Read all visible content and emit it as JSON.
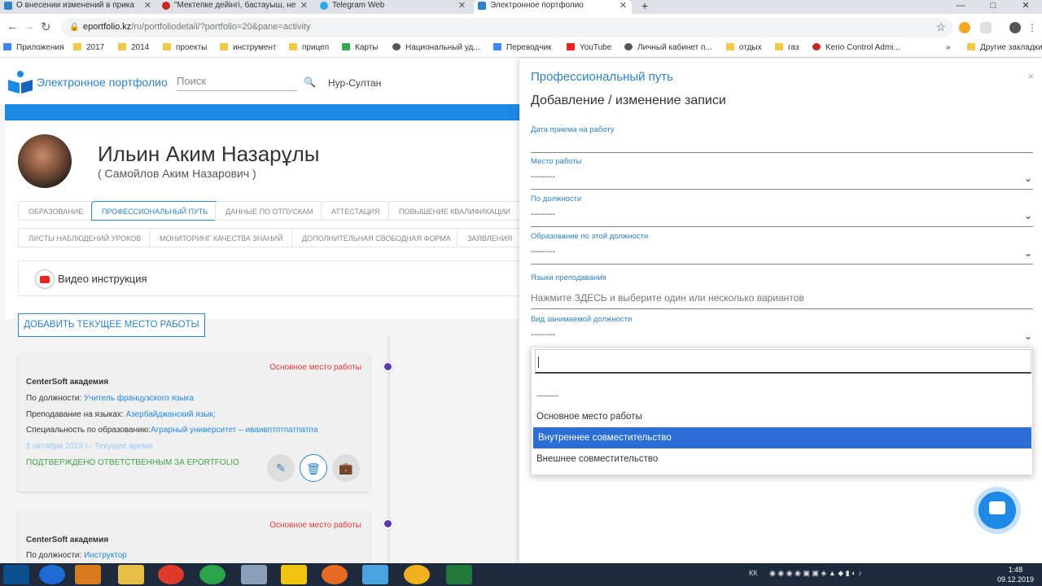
{
  "browser": {
    "tabs": [
      {
        "title": "О внесении изменений в прика",
        "color": "#2e82c6"
      },
      {
        "title": "\"Мектепке дейінгі, бастауыш, не",
        "color": "#c62828"
      },
      {
        "title": "Telegram Web",
        "color": "#29a9eb"
      },
      {
        "title": "Электронное портфолио",
        "color": "#2e82c6"
      }
    ],
    "new_tab": "+",
    "window_controls": [
      "—",
      "□",
      "✕"
    ],
    "url_host": "eportfolio.kz",
    "url_path": "/ru/portfoliodetail/?portfolio=20&pane=activity",
    "bookmarks": [
      "Приложения",
      "2017",
      "2014",
      "проекты",
      "инструмент",
      "прицеп",
      "Карты",
      "Национальный уд...",
      "Переводчик",
      "YouTube",
      "Личный кабинет п...",
      "отдых",
      "газ",
      "Kerio Control Admi...",
      "Другие закладки"
    ]
  },
  "site": {
    "brand": "Электронное портфолио",
    "search_placeholder": "Поиск",
    "city": "Нур-Султан"
  },
  "profile": {
    "name": "Ильин Аким Назарұлы",
    "alt_name": "( Самойлов Аким Назарович )"
  },
  "profile_tabs_row1": [
    "ОБРАЗОВАНИЕ",
    "ПРОФЕССИОНАЛЬНЫЙ ПУТЬ",
    "ДАННЫЕ ПО ОТПУСКАМ",
    "АТТЕСТАЦИЯ",
    "ПОВЫШЕНИЕ КВАЛИФИКАЦИИ"
  ],
  "profile_tabs_row2": [
    "ЛИСТЫ НАБЛЮДЕНИЙ УРОКОВ",
    "МОНИТОРИНГ КАЧЕСТВА ЗНАНИЙ",
    "ДОПОЛНИТЕЛЬНАЯ СВОБОДНАЯ ФОРМА",
    "ЗАЯВЛЕНИЯ"
  ],
  "video": {
    "label": "Видео инструкция"
  },
  "add_button": "ДОБАВИТЬ ТЕКУЩЕЕ МЕСТО РАБОТЫ",
  "jobs": [
    {
      "type": "Основное место работы",
      "org": "CenterSoft академия",
      "position_label": "По должности:",
      "position": "Учитель французского языка",
      "languages_label": "Преподавание на языках:",
      "languages": "Азербайджанский язык;",
      "specialty_label": "Специальность по образованию:",
      "specialty": "Аграрный университет – иваивптптпатпатпа",
      "date": "1 октября 2019 г.- Текущее время",
      "confirmed": "ПОДТВЕРЖДЕНО ОТВЕТСТВЕННЫМ ЗА EPORTFOLIO"
    },
    {
      "type": "Основное место работы",
      "org": "CenterSoft академия",
      "position_label": "По должности:",
      "position": "Инструктор"
    }
  ],
  "panel": {
    "title": "Профессиональный путь",
    "subtitle": "Добавление / изменение записи",
    "close": "×",
    "fields": {
      "hire_date": {
        "label": "Дата приема на работу",
        "value": ""
      },
      "workplace": {
        "label": "Место работы",
        "value": "---------"
      },
      "position": {
        "label": "По должности",
        "value": "---------"
      },
      "education": {
        "label": "Образование по этой должности",
        "value": "---------"
      },
      "languages": {
        "label": "Языки преподавания",
        "placeholder": "Нажмите ЗДЕСЬ и выберите один или несколько вариантов"
      },
      "position_type": {
        "label": "Вид занимаемой должности",
        "value": "---------"
      }
    },
    "dropdown_options": [
      "---------",
      "Основное место работы",
      "Внутреннее совместительство",
      "Внешнее совместительство"
    ],
    "dropdown_selected": "Внутреннее совместительство"
  },
  "taskbar": {
    "lang": "КК",
    "time": "1:48",
    "date": "09.12.2019"
  },
  "colors": {
    "accent": "#2e82c6",
    "selected_option": "#2a6ed6",
    "primary_job": "#e53935",
    "confirmed": "#43a047",
    "timeline_dot": "#5e35b1"
  }
}
